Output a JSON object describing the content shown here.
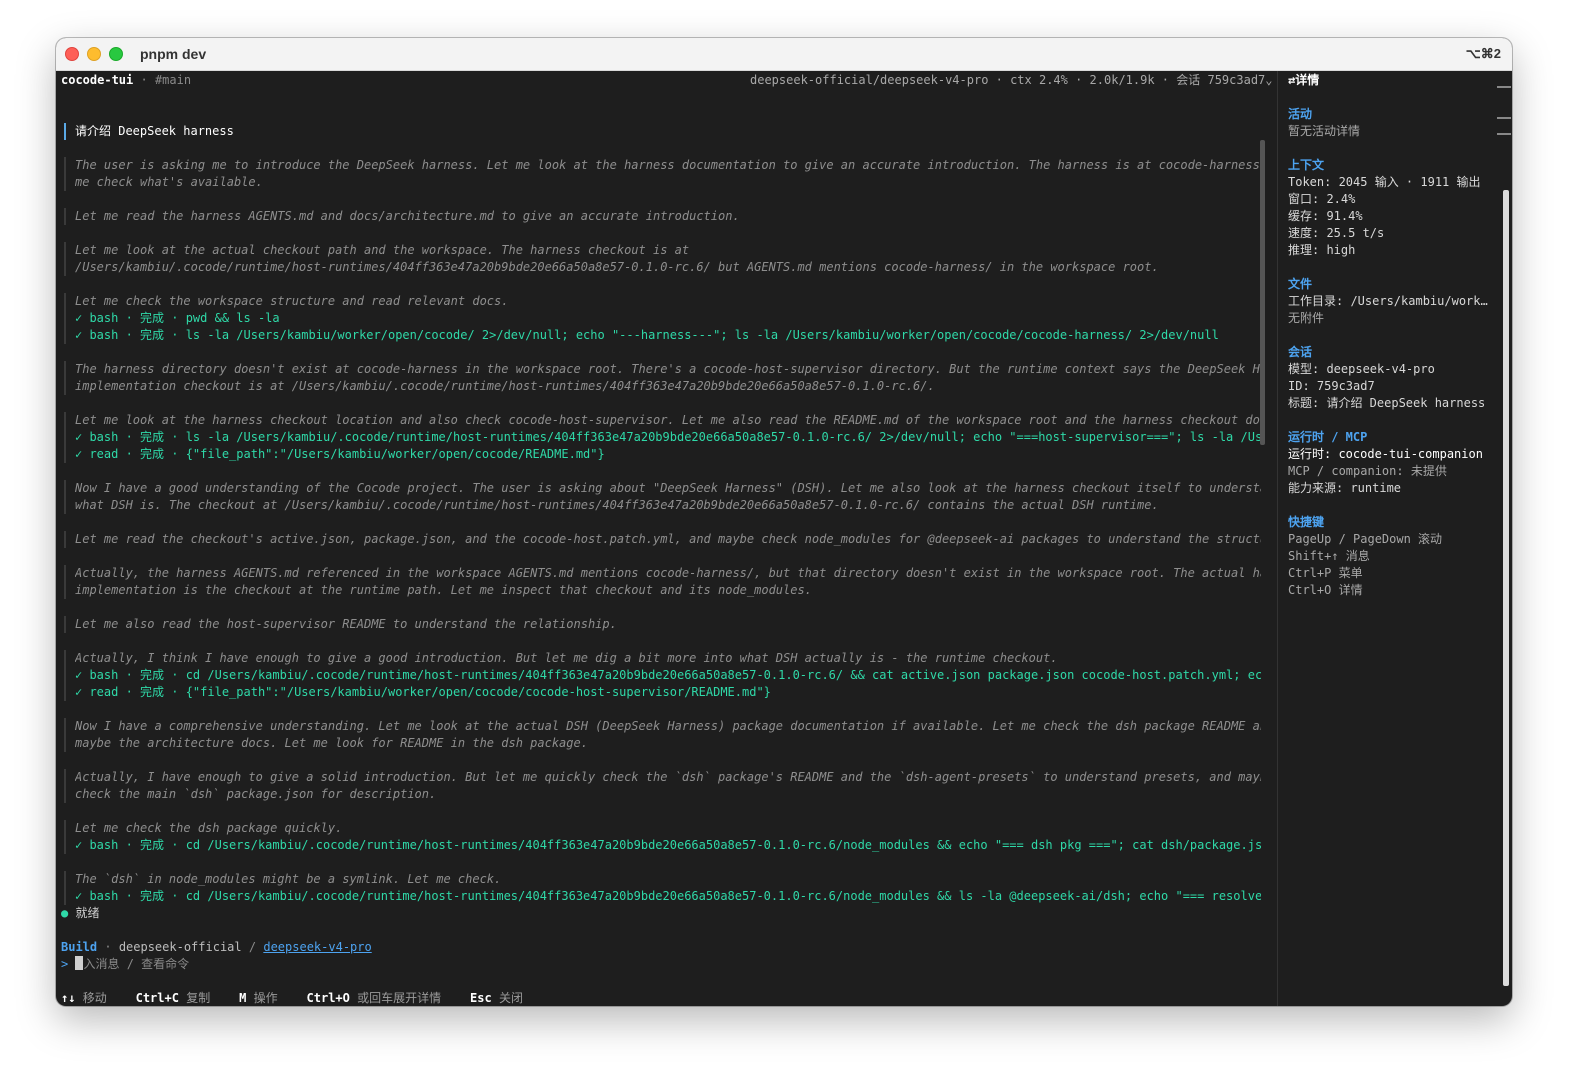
{
  "window": {
    "title": "pnpm dev",
    "shortcut": "⌥⌘2"
  },
  "header": {
    "app": "cocode-tui",
    "branch": "#main",
    "info": "deepseek-official/deepseek-v4-pro · ctx  2.4% · 2.0k/1.9k · 会话 759c3ad7",
    "info_arrow": "⌄"
  },
  "transcript": {
    "user_prompt": "请介绍 DeepSeek harness",
    "lines": [
      "The user is asking me to introduce the DeepSeek harness. Let me look at the harness documentation to give an accurate introduction. The harness is at cocode-harness/. Let",
      " me check what's available.",
      "Let me read the harness AGENTS.md and docs/architecture.md to give an accurate introduction.",
      "Let me look at the actual checkout path and the workspace. The harness checkout is at",
      "/Users/kambiu/.cocode/runtime/host-runtimes/404ff363e47a20b9bde20e66a50a8e57-0.1.0-rc.6/ but AGENTS.md mentions cocode-harness/ in the workspace root.",
      "Let me check the workspace structure and read relevant docs.",
      "The harness directory doesn't exist at cocode-harness in the workspace root. There's a cocode-host-supervisor directory. But the runtime context says the DeepSeek Harness",
      " implementation checkout is at /Users/kambiu/.cocode/runtime/host-runtimes/404ff363e47a20b9bde20e66a50a8e57-0.1.0-rc.6/.",
      "Let me look at the harness checkout location and also check cocode-host-supervisor. Let me also read the README.md of the workspace root and the harness checkout docs.",
      "Now I have a good understanding of the Cocode project. The user is asking about \"DeepSeek Harness\" (DSH). Let me also look at the harness checkout itself to understand",
      "what DSH is. The checkout at /Users/kambiu/.cocode/runtime/host-runtimes/404ff363e47a20b9bde20e66a50a8e57-0.1.0-rc.6/ contains the actual DSH runtime.",
      "Let me read the checkout's active.json, package.json, and the cocode-host.patch.yml, and maybe check node_modules for @deepseek-ai packages to understand the structure.",
      "Actually, the harness AGENTS.md referenced in the workspace AGENTS.md mentions cocode-harness/, but that directory doesn't exist in the workspace root. The actual harness",
      " implementation is the checkout at the runtime path. Let me inspect that checkout and its node_modules.",
      "Let me also read the host-supervisor README to understand the relationship.",
      "Actually, I think I have enough to give a good introduction. But let me dig a bit more into what DSH actually is - the runtime checkout.",
      "Now I have a comprehensive understanding. Let me look at the actual DSH (DeepSeek Harness) package documentation if available. Let me check the dsh package README and",
      "maybe the architecture docs. Let me look for README in the dsh package.",
      "Actually, I have enough to give a solid introduction. But let me quickly check the `dsh` package's README and the `dsh-agent-presets` to understand presets, and maybe",
      "check the main `dsh` package.json for description.",
      "Let me check the dsh package quickly.",
      "The `dsh` in node_modules might be a symlink. Let me check."
    ],
    "tools": [
      "✓ bash · 完成 · pwd && ls -la",
      "✓ bash · 完成 · ls -la /Users/kambiu/worker/open/cocode/ 2>/dev/null; echo \"---harness---\"; ls -la /Users/kambiu/worker/open/cocode/cocode-harness/ 2>/dev/null",
      "✓ bash · 完成 · ls -la /Users/kambiu/.cocode/runtime/host-runtimes/404ff363e47a20b9bde20e66a50a8e57-0.1.0-rc.6/ 2>/dev/null; echo \"===host-supervisor===\"; ls -la /Users/kambiu/worker/open",
      "✓ read · 完成 · {\"file_path\":\"/Users/kambiu/worker/open/cocode/README.md\"}",
      "✓ bash · 完成 · cd /Users/kambiu/.cocode/runtime/host-runtimes/404ff363e47a20b9bde20e66a50a8e57-0.1.0-rc.6/ && cat active.json package.json cocode-host.patch.yml; echo \"---",
      "✓ read · 完成 · {\"file_path\":\"/Users/kambiu/worker/open/cocode/cocode-host-supervisor/README.md\"}",
      "✓ bash · 完成 · cd /Users/kambiu/.cocode/runtime/host-runtimes/404ff363e47a20b9bde20e66a50a8e57-0.1.0-rc.6/node_modules && echo \"=== dsh pkg ===\"; cat dsh/package.json |",
      "✓ bash · 完成 · cd /Users/kambiu/.cocode/runtime/host-runtimes/404ff363e47a20b9bde20e66a50a8e57-0.1.0-rc.6/node_modules && ls -la @deepseek-ai/dsh; echo \"=== resolve ==="
    ]
  },
  "status": {
    "dot": "●",
    "text": "就绪"
  },
  "build": {
    "label": "Build",
    "provider": "deepseek-official",
    "sep": "/",
    "model": "deepseek-v4-pro"
  },
  "input": {
    "arrow": ">",
    "placeholder_rest": "入消息  / 查看命令"
  },
  "footer": {
    "k1": "↑↓",
    "t1": "移动",
    "k2": "Ctrl+C",
    "t2": "复制",
    "k3": "M",
    "t3": "操作",
    "k4": "Ctrl+O",
    "t4": "或回车展开详情",
    "k5": "Esc",
    "t5": "关闭"
  },
  "sidebar": {
    "title": "⇄详情",
    "activity_head": "活动",
    "activity_empty": "暂无活动详情",
    "context_head": "上下文",
    "token": "Token: 2045 输入 · 1911 输出",
    "window": "窗口: 2.4%",
    "cache": "缓存: 91.4%",
    "speed": "速度: 25.5 t/s",
    "reasoning": "推理: high",
    "files_head": "文件",
    "workdir": "工作目录: /Users/kambiu/worker/open/cocode",
    "no_attach": "无附件",
    "session_head": "会话",
    "model": "模型: deepseek-v4-pro",
    "id": "ID: 759c3ad7",
    "session_title": "标题: 请介绍 DeepSeek harness",
    "runtime_head": "运行时 / MCP",
    "runtime": "运行时: cocode-tui-companion",
    "mcp": "MCP / companion: 未提供",
    "capability": "能力来源: runtime",
    "keys_head": "快捷键",
    "key1": "PageUp / PageDown 滚动",
    "key2": "Shift+↑ 消息",
    "key3": "Ctrl+P 菜单",
    "key4": "Ctrl+O 详情"
  },
  "colors": {
    "accent": "#4da3f0",
    "success": "#2fd9a8",
    "background": "#1e1e1e"
  }
}
